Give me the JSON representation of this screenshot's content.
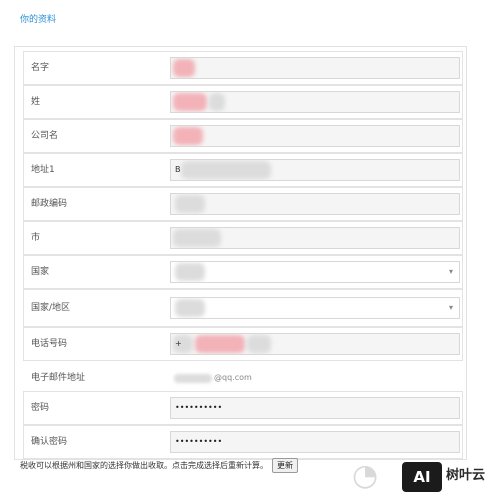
{
  "section_title": "你的资料",
  "fields": [
    {
      "label": "名字",
      "kind": "text",
      "value": ""
    },
    {
      "label": "姓",
      "kind": "text",
      "value": ""
    },
    {
      "label": "公司名",
      "kind": "text",
      "value": ""
    },
    {
      "label": "地址1",
      "kind": "text",
      "value": "B"
    },
    {
      "label": "邮政编码",
      "kind": "text",
      "value": ""
    },
    {
      "label": "市",
      "kind": "text",
      "value": ""
    },
    {
      "label": "国家",
      "kind": "select",
      "value": ""
    },
    {
      "label": "国家/地区",
      "kind": "select",
      "value": ""
    },
    {
      "label": "电话号码",
      "kind": "text",
      "value": "+"
    },
    {
      "label": "电子邮件地址",
      "kind": "readonly",
      "value": "@qq.com"
    },
    {
      "label": "密码",
      "kind": "password",
      "value": "••••••••••"
    },
    {
      "label": "确认密码",
      "kind": "password",
      "value": "••••••••••"
    }
  ],
  "bottom_note": "税收可以根据州和国家的选择你做出收取。点击完成选择后重新计算。",
  "update_button": "更新",
  "watermark": {
    "logo": "AI",
    "text": "树叶云"
  },
  "colors": {
    "title": "#2a8fd8",
    "blur": "#f2b2b8"
  }
}
